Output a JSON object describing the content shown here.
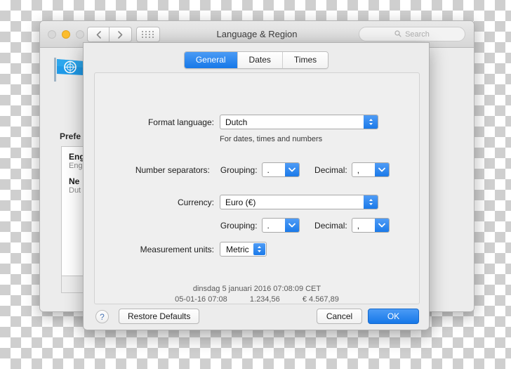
{
  "window": {
    "title": "Language & Region",
    "search_placeholder": "Search",
    "traffic_lights": [
      "close",
      "minimize",
      "zoom"
    ],
    "preferred_label": "Prefe",
    "languages": [
      {
        "name": "Eng",
        "sub": "Eng"
      },
      {
        "name": "Ne",
        "sub": "Dut"
      }
    ],
    "add_button": "+",
    "help_button": "?"
  },
  "sheet": {
    "tabs": [
      {
        "label": "General",
        "active": true
      },
      {
        "label": "Dates",
        "active": false
      },
      {
        "label": "Times",
        "active": false
      }
    ],
    "format_language": {
      "label": "Format language:",
      "value": "Dutch",
      "hint": "For dates, times and numbers"
    },
    "number_separators": {
      "label": "Number separators:",
      "grouping_label": "Grouping:",
      "grouping_value": ".",
      "decimal_label": "Decimal:",
      "decimal_value": ","
    },
    "currency": {
      "label": "Currency:",
      "value": "Euro (€)",
      "grouping_label": "Grouping:",
      "grouping_value": ".",
      "decimal_label": "Decimal:",
      "decimal_value": ","
    },
    "measurement_units": {
      "label": "Measurement units:",
      "value": "Metric"
    },
    "preview": {
      "line1": "dinsdag 5 januari 2016 07:08:09 CET",
      "date_short": "05-01-16 07:08",
      "number_sample": "1.234,56",
      "currency_sample": "€ 4.567,89"
    },
    "footer": {
      "help": "?",
      "restore_defaults": "Restore Defaults",
      "cancel": "Cancel",
      "ok": "OK"
    }
  },
  "colors": {
    "accent_blue": "#1678e8",
    "window_gray": "#ececec",
    "panel_gray": "#efefef",
    "amber_light": "#fcbd2e"
  }
}
